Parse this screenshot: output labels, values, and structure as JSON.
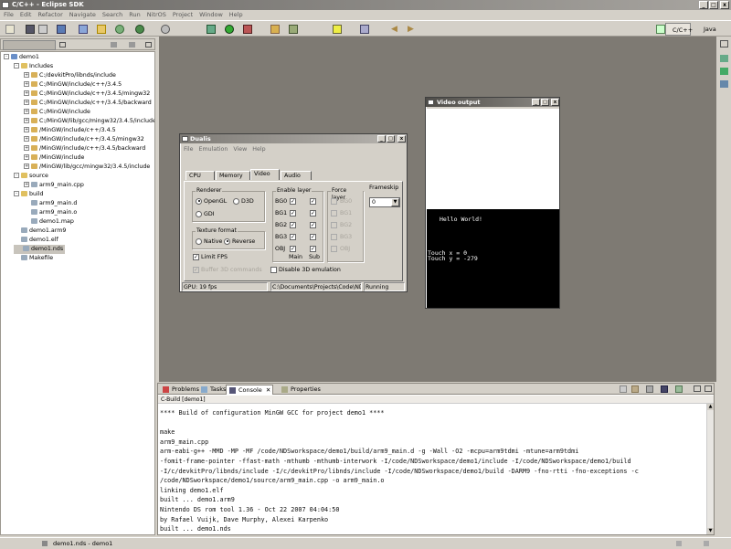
{
  "window": {
    "title": "C/C++ - Eclipse SDK"
  },
  "menu": [
    "File",
    "Edit",
    "Refactor",
    "Navigate",
    "Search",
    "Run",
    "NitrOS",
    "Project",
    "Window",
    "Help"
  ],
  "perspectives": {
    "active": "C/C++",
    "other": "Java"
  },
  "project_explorer": {
    "rows": [
      {
        "label": "demo1",
        "indent": 0,
        "kind": "project",
        "expander": "-"
      },
      {
        "label": "Includes",
        "indent": 1,
        "kind": "folder",
        "expander": "-"
      },
      {
        "label": "C:/devkitPro/libnds/include",
        "indent": 2,
        "kind": "inc",
        "expander": "+"
      },
      {
        "label": "C:/MinGW/include/c++/3.4.5",
        "indent": 2,
        "kind": "inc",
        "expander": "+"
      },
      {
        "label": "C:/MinGW/include/c++/3.4.5/mingw32",
        "indent": 2,
        "kind": "inc",
        "expander": "+"
      },
      {
        "label": "C:/MinGW/include/c++/3.4.5/backward",
        "indent": 2,
        "kind": "inc",
        "expander": "+"
      },
      {
        "label": "C:/MinGW/include",
        "indent": 2,
        "kind": "inc",
        "expander": "+"
      },
      {
        "label": "C:/MinGW/lib/gcc/mingw32/3.4.5/include",
        "indent": 2,
        "kind": "inc",
        "expander": "+"
      },
      {
        "label": "/MinGW/include/c++/3.4.5",
        "indent": 2,
        "kind": "inc",
        "expander": "+"
      },
      {
        "label": "/MinGW/include/c++/3.4.5/mingw32",
        "indent": 2,
        "kind": "inc",
        "expander": "+"
      },
      {
        "label": "/MinGW/include/c++/3.4.5/backward",
        "indent": 2,
        "kind": "inc",
        "expander": "+"
      },
      {
        "label": "/MinGW/include",
        "indent": 2,
        "kind": "inc",
        "expander": "+"
      },
      {
        "label": "/MinGW/lib/gcc/mingw32/3.4.5/include",
        "indent": 2,
        "kind": "inc",
        "expander": "+"
      },
      {
        "label": "source",
        "indent": 1,
        "kind": "folder",
        "expander": "-"
      },
      {
        "label": "arm9_main.cpp",
        "indent": 2,
        "kind": "file",
        "expander": "+"
      },
      {
        "label": "build",
        "indent": 1,
        "kind": "folder",
        "expander": "-"
      },
      {
        "label": "arm9_main.d",
        "indent": 2,
        "kind": "file",
        "expander": ""
      },
      {
        "label": "arm9_main.o",
        "indent": 2,
        "kind": "file",
        "expander": ""
      },
      {
        "label": "demo1.map",
        "indent": 2,
        "kind": "file",
        "expander": ""
      },
      {
        "label": "demo1.arm9",
        "indent": 1,
        "kind": "file",
        "expander": ""
      },
      {
        "label": "demo1.elf",
        "indent": 1,
        "kind": "file",
        "expander": ""
      },
      {
        "label": "demo1.nds",
        "indent": 1,
        "kind": "file",
        "expander": "",
        "selected": true
      },
      {
        "label": "Makefile",
        "indent": 1,
        "kind": "file",
        "expander": ""
      }
    ]
  },
  "dualis": {
    "title": "Dualis",
    "menu": [
      "File",
      "Emulation",
      "View",
      "Help"
    ],
    "tabs": [
      "CPU",
      "Memory",
      "Video",
      "Audio"
    ],
    "active_tab": "Video",
    "renderer": {
      "label": "Renderer",
      "options": [
        "OpenGL",
        "D3D",
        "GDI"
      ],
      "selected": "OpenGL"
    },
    "texture": {
      "label": "Texture format",
      "options": [
        "Native",
        "Reverse"
      ],
      "selected": "Reverse"
    },
    "limit_fps": "Limit FPS",
    "buffer_3d": "Buffer 3D commands",
    "enable_layer": {
      "label": "Enable layer",
      "rows": [
        "BG0",
        "BG1",
        "BG2",
        "BG3",
        "OBJ"
      ],
      "main": "Main",
      "sub": "Sub"
    },
    "force_layer": {
      "label": "Force layer",
      "rows": [
        "BG0",
        "BG1",
        "BG2",
        "BG3",
        "OBJ"
      ]
    },
    "frameskip": {
      "label": "Frameskip",
      "value": "0"
    },
    "disable_3d": "Disable 3D emulation",
    "status": {
      "fps": "GPU: 19 fps",
      "path": "C:\\Documents\\Projects\\Code\\NDS\\",
      "state": "Running"
    }
  },
  "video_output": {
    "title": "Video output",
    "line1": "Hello World!",
    "line2": "Touch x = 0",
    "line3": "Touch y = -279"
  },
  "console": {
    "tabs": [
      "Problems",
      "Tasks",
      "Console",
      "Properties"
    ],
    "active_tab": "Console",
    "header": "C-Build [demo1]",
    "lines": [
      "**** Build of configuration MinGW GCC for project demo1 ****",
      "",
      "make",
      "arm9_main.cpp",
      "arm-eabi-g++ -MMD -MP -MF /code/NDSworkspace/demo1/build/arm9_main.d -g -Wall -O2 -mcpu=arm9tdmi -mtune=arm9tdmi",
      "-fomit-frame-pointer -ffast-math -mthumb -mthumb-interwork -I/code/NDSworkspace/demo1/include -I/code/NDSworkspace/demo1/build",
      "-I/c/devkitPro/libnds/include -I/c/devkitPro/libnds/include -I/code/NDSworkspace/demo1/build -DARM9 -fno-rtti -fno-exceptions -c",
      "/code/NDSworkspace/demo1/source/arm9_main.cpp -o arm9_main.o",
      "linking demo1.elf",
      "built ... demo1.arm9",
      "Nintendo DS rom tool 1.36 - Oct 22 2007 04:04:50",
      "by Rafael Vuijk, Dave Murphy, Alexei Karpenko",
      "built ... demo1.nds"
    ]
  },
  "status_bar": {
    "text": "demo1.nds - demo1"
  },
  "colors": {
    "desktop": "#d4d0c8",
    "editor": "#7e7a73",
    "title_grad_start": "#6b6966",
    "selection": "#c8c4bc"
  }
}
